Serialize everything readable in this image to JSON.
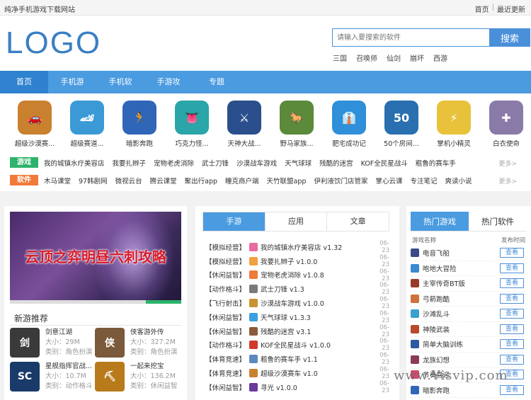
{
  "topbar": {
    "site_name": "纯净手机游戏下载网站",
    "home": "首页",
    "sep": "|",
    "latest": "最近更新"
  },
  "header": {
    "logo": "LOGO",
    "search_placeholder": "请输入要搜索的软件",
    "search_button": "搜索",
    "hotwords": [
      "三国",
      "召唤师",
      "仙剑",
      "崩坏",
      "西游"
    ]
  },
  "nav": [
    "首页",
    "手机游戏",
    "手机软件",
    "手游攻略",
    "专题"
  ],
  "apps": [
    {
      "name": "超级沙漠赛...",
      "color": "#c9812f",
      "glyph": "🚗"
    },
    {
      "name": "超级赛道...",
      "color": "#3b9ad6",
      "glyph": "🏎"
    },
    {
      "name": "暗影奔跑",
      "color": "#2f66b8",
      "glyph": "🏃"
    },
    {
      "name": "巧克力怪...",
      "color": "#2aa5a8",
      "glyph": "👅"
    },
    {
      "name": "天神大战...",
      "color": "#2a4f8c",
      "glyph": "⚔"
    },
    {
      "name": "野马家族...",
      "color": "#5a8a3a",
      "glyph": "🐎"
    },
    {
      "name": "肥宅成功记",
      "color": "#2f8fd8",
      "glyph": "👔"
    },
    {
      "name": "50个房间...",
      "color": "#2a6fb0",
      "glyph": "50"
    },
    {
      "name": "掌机小精灵",
      "color": "#e8c23a",
      "glyph": "⚡"
    },
    {
      "name": "白衣使命",
      "color": "#8a7aa8",
      "glyph": "✚"
    }
  ],
  "game_row": {
    "tag": "游戏",
    "links": [
      "我的城镇水疗美容店",
      "我要扎辫子",
      "宠物老虎消除",
      "武士刀锋",
      "沙漠战车游戏",
      "天气球球",
      "残酷的迷宫",
      "KOF全民星战斗",
      "粗鲁的赛车手"
    ],
    "more": "更多>"
  },
  "soft_row": {
    "tag": "软件",
    "links": [
      "木马课堂",
      "97韩剧网",
      "微视云台",
      "腾云课堂",
      "聚出行app",
      "瞳克商户端",
      "天竹联盟app",
      "伊利液饮门店管家",
      "掌心云课",
      "专注笔记",
      "爽读小说"
    ],
    "more": "更多>"
  },
  "banner": {
    "caption": "云顶之弈明昼六刺攻略"
  },
  "new_games": {
    "title": "新游推荐",
    "size_label": "大小：",
    "cat_label": "类别：",
    "items": [
      {
        "name": "剑意江湖",
        "size": "29M",
        "category": "角色扮演",
        "color": "#3a3a3a",
        "glyph": "剑"
      },
      {
        "name": "侠客游外传",
        "size": "327.2M",
        "category": "角色扮演",
        "color": "#7a5a3a",
        "glyph": "侠"
      },
      {
        "name": "星舰指挥官战...",
        "size": "10.7M",
        "category": "动作格斗",
        "color": "#1a3a6a",
        "glyph": "SC"
      },
      {
        "name": "一起来挖宝",
        "size": "136.2M",
        "category": "休闲益智",
        "color": "#b87a1a",
        "glyph": "⛏"
      }
    ]
  },
  "tabs_mid": [
    "手游",
    "应用",
    "文章"
  ],
  "mid_list": [
    {
      "cat": "【模拟经营】",
      "name": "我的城镇水疗美容店 v1.32",
      "date": "06-23",
      "color": "#e86aa0"
    },
    {
      "cat": "【模拟经营】",
      "name": "我要扎辫子 v1.0.0",
      "date": "06-23",
      "color": "#f0a040"
    },
    {
      "cat": "【休闲益智】",
      "name": "宠物老虎消除 v1.0.8",
      "date": "06-23",
      "color": "#f07a3a"
    },
    {
      "cat": "【动作格斗】",
      "name": "武士刀锋 v1.3",
      "date": "06-23",
      "color": "#7a7a7a"
    },
    {
      "cat": "【飞行射击】",
      "name": "沙漠战车游戏 v1.0.0",
      "date": "06-23",
      "color": "#c9912f"
    },
    {
      "cat": "【休闲益智】",
      "name": "天气球球 v1.3.3",
      "date": "06-23",
      "color": "#3aa0e0"
    },
    {
      "cat": "【休闲益智】",
      "name": "残酷的迷宫 v3.1",
      "date": "06-23",
      "color": "#8a5a3a"
    },
    {
      "cat": "【动作格斗】",
      "name": "KOF全民星战斗 v1.0.0",
      "date": "06-23",
      "color": "#d03a2a"
    },
    {
      "cat": "【体育竞速】",
      "name": "粗鲁的赛车手 v1.1",
      "date": "06-23",
      "color": "#5a8ac0"
    },
    {
      "cat": "【体育竞速】",
      "name": "超级沙漠赛车 v1.0",
      "date": "06-23",
      "color": "#c9812f"
    },
    {
      "cat": "【休闲益智】",
      "name": "寻光 v1.0.0",
      "date": "06-23",
      "color": "#6a3a9a"
    }
  ],
  "tabs_right": [
    "热门游戏",
    "热门软件"
  ],
  "hot_header": {
    "name": "游戏名称",
    "time": "发布时间"
  },
  "hot_list": [
    {
      "name": "电音飞船",
      "color": "#3a4a8a"
    },
    {
      "name": "咆地大冒险",
      "color": "#3a8ad0"
    },
    {
      "name": "主宰传奇BT版",
      "color": "#9a3a2a"
    },
    {
      "name": "弓箭跑酷",
      "color": "#d0703a"
    },
    {
      "name": "沙滩乱斗",
      "color": "#3aa0d0"
    },
    {
      "name": "神陵武装",
      "color": "#b84a2a"
    },
    {
      "name": "简单大脑训练",
      "color": "#2a5aa0"
    },
    {
      "name": "龙族幻想",
      "color": "#8a3a5a"
    },
    {
      "name": "节奏喜迎",
      "color": "#d04a6a"
    },
    {
      "name": "暗影奔跑",
      "color": "#2f66b8"
    }
  ],
  "hot_button": "查看",
  "watermark": "www.Yisvip.com"
}
